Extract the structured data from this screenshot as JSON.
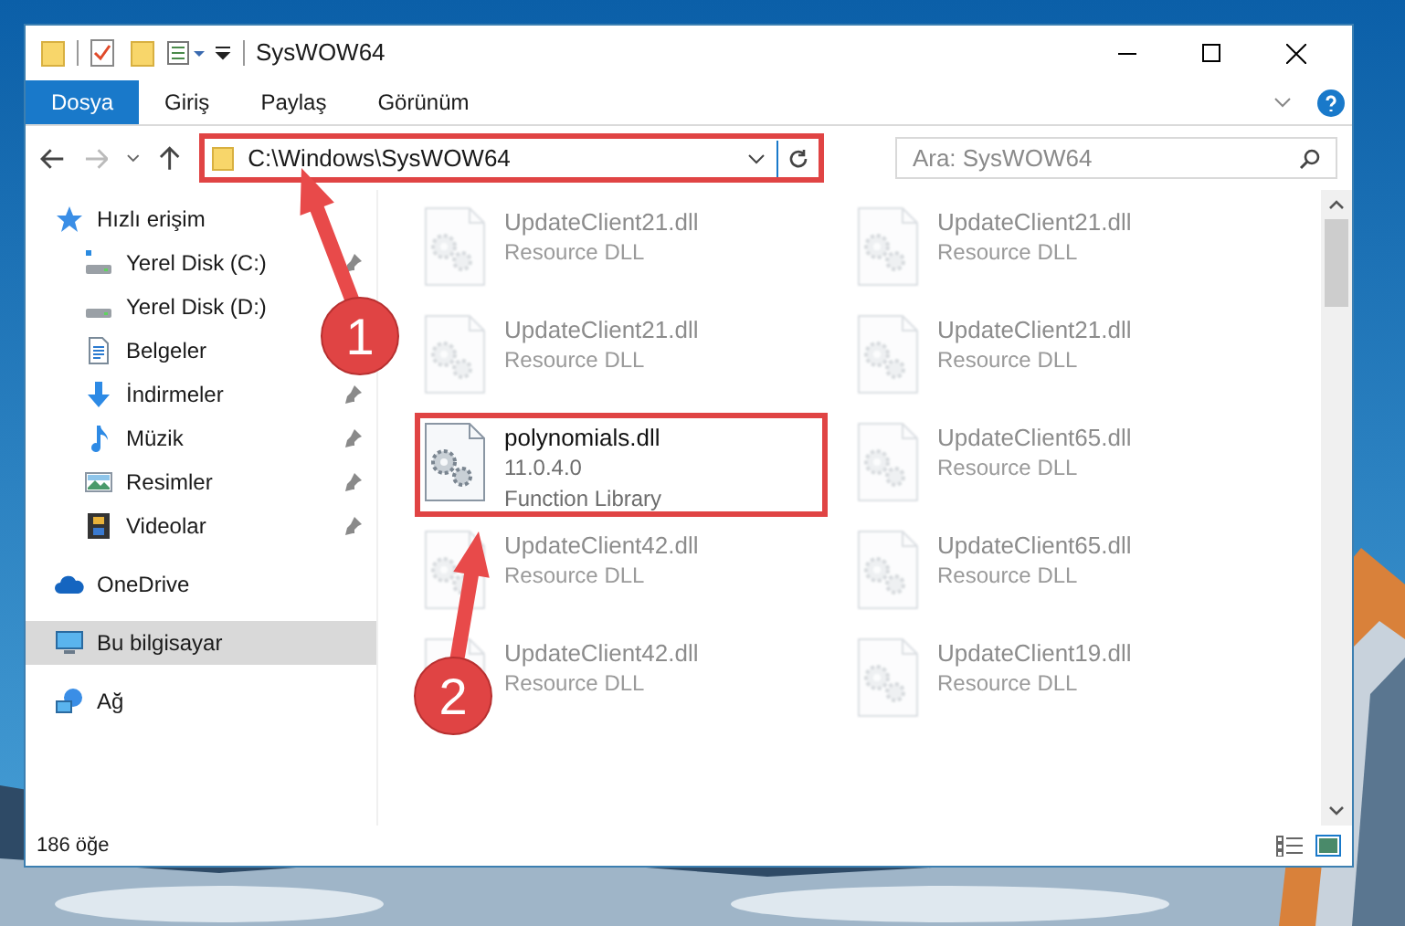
{
  "window": {
    "title": "SysWOW64"
  },
  "ribbon_tabs": [
    {
      "label": "Dosya",
      "selected": true
    },
    {
      "label": "Giriş",
      "selected": false
    },
    {
      "label": "Paylaş",
      "selected": false
    },
    {
      "label": "Görünüm",
      "selected": false
    }
  ],
  "address_bar": {
    "path": "C:\\Windows\\SysWOW64",
    "highlighted": true
  },
  "search": {
    "placeholder": "Ara: SysWOW64"
  },
  "navigation": [
    {
      "label": "Hızlı erişim",
      "kind": "star",
      "selected": false,
      "children": [
        {
          "label": "Yerel Disk (C:)",
          "kind": "system-drive",
          "pinned": true
        },
        {
          "label": "Yerel Disk (D:)",
          "kind": "drive",
          "pinned": false
        },
        {
          "label": "Belgeler",
          "kind": "document",
          "pinned": false
        },
        {
          "label": "İndirmeler",
          "kind": "download",
          "pinned": true
        },
        {
          "label": "Müzik",
          "kind": "music",
          "pinned": true
        },
        {
          "label": "Resimler",
          "kind": "pictures",
          "pinned": true
        },
        {
          "label": "Videolar",
          "kind": "videos",
          "pinned": true
        }
      ]
    },
    {
      "label": "OneDrive",
      "kind": "cloud",
      "selected": false
    },
    {
      "label": "Bu bilgisayar",
      "kind": "computer",
      "selected": true
    },
    {
      "label": "Ağ",
      "kind": "network",
      "selected": false
    }
  ],
  "files": [
    {
      "name": "UpdateClient21.dll",
      "lines": [
        "Resource DLL"
      ],
      "highlighted": false
    },
    {
      "name": "UpdateClient21.dll",
      "lines": [
        "Resource DLL"
      ],
      "highlighted": false
    },
    {
      "name": "UpdateClient21.dll",
      "lines": [
        "Resource DLL"
      ],
      "highlighted": false
    },
    {
      "name": "UpdateClient21.dll",
      "lines": [
        "Resource DLL"
      ],
      "highlighted": false
    },
    {
      "name": "polynomials.dll",
      "lines": [
        "11.0.4.0",
        "Function Library"
      ],
      "highlighted": true
    },
    {
      "name": "UpdateClient65.dll",
      "lines": [
        "Resource DLL"
      ],
      "highlighted": false
    },
    {
      "name": "UpdateClient42.dll",
      "lines": [
        "Resource DLL"
      ],
      "highlighted": false
    },
    {
      "name": "UpdateClient65.dll",
      "lines": [
        "Resource DLL"
      ],
      "highlighted": false
    },
    {
      "name": "UpdateClient42.dll",
      "lines": [
        "Resource DLL"
      ],
      "highlighted": false
    },
    {
      "name": "UpdateClient19.dll",
      "lines": [
        "Resource DLL"
      ],
      "highlighted": false
    }
  ],
  "status_bar": {
    "count": "186 öğe"
  },
  "callouts": [
    {
      "label": "1"
    },
    {
      "label": "2"
    }
  ]
}
